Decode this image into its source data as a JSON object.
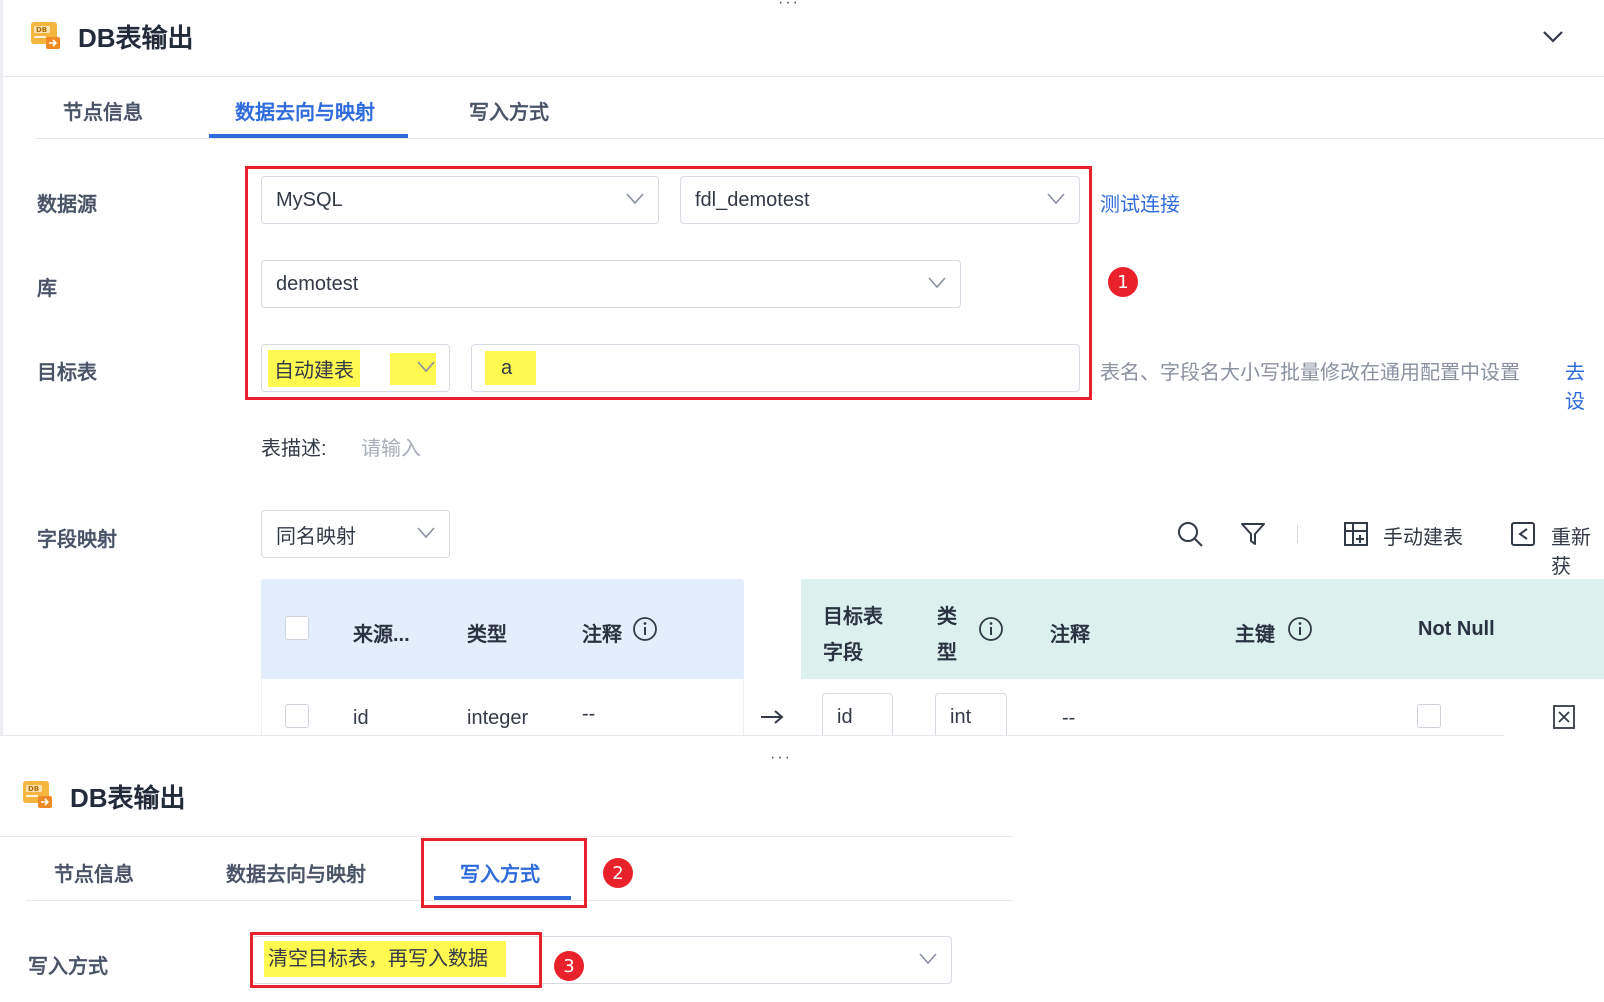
{
  "top_panel": {
    "title": "DB表输出",
    "tabs": [
      {
        "label": "节点信息"
      },
      {
        "label": "数据去向与映射"
      },
      {
        "label": "写入方式"
      }
    ],
    "form": {
      "datasource_label": "数据源",
      "datasource_type": "MySQL",
      "datasource_conn": "fdl_demotest",
      "test_connection": "测试连接",
      "database_label": "库",
      "database_value": "demotest",
      "target_table_label": "目标表",
      "target_table_mode": "自动建表",
      "target_table_name": "a",
      "case_hint": "表名、字段名大小写批量修改在通用配置中设置",
      "goto_settings": "去设",
      "table_desc_label": "表描述:",
      "table_desc_placeholder": "请输入",
      "field_mapping_label": "字段映射",
      "field_mapping_mode": "同名映射"
    },
    "toolbar": {
      "manual_create": "手动建表",
      "refresh": "重新获"
    },
    "source_table": {
      "headers": [
        "来源...",
        "类型",
        "注释"
      ],
      "rows": [
        {
          "name": "id",
          "type": "integer",
          "comment": "--"
        }
      ]
    },
    "target_table": {
      "headers": {
        "field_line1": "目标表",
        "field_line2": "字段",
        "type_line1": "类",
        "type_line2": "型",
        "comment": "注释",
        "primary_key": "主键",
        "not_null": "Not Null"
      },
      "rows": [
        {
          "field": "id",
          "type": "int",
          "comment": "--"
        }
      ]
    },
    "badge": "1"
  },
  "bottom_panel": {
    "title": "DB表输出",
    "tabs": [
      {
        "label": "节点信息"
      },
      {
        "label": "数据去向与映射"
      },
      {
        "label": "写入方式"
      }
    ],
    "tab_badge": "2",
    "write_mode_label": "写入方式",
    "write_mode_value": "清空目标表，再写入数据",
    "field_badge": "3"
  },
  "colors": {
    "accent": "#2f6bdc",
    "annotation_red": "#e8212b",
    "highlight_yellow": "#fff950",
    "source_header_bg": "#e3edfb",
    "target_header_bg": "#dcf1ee"
  }
}
